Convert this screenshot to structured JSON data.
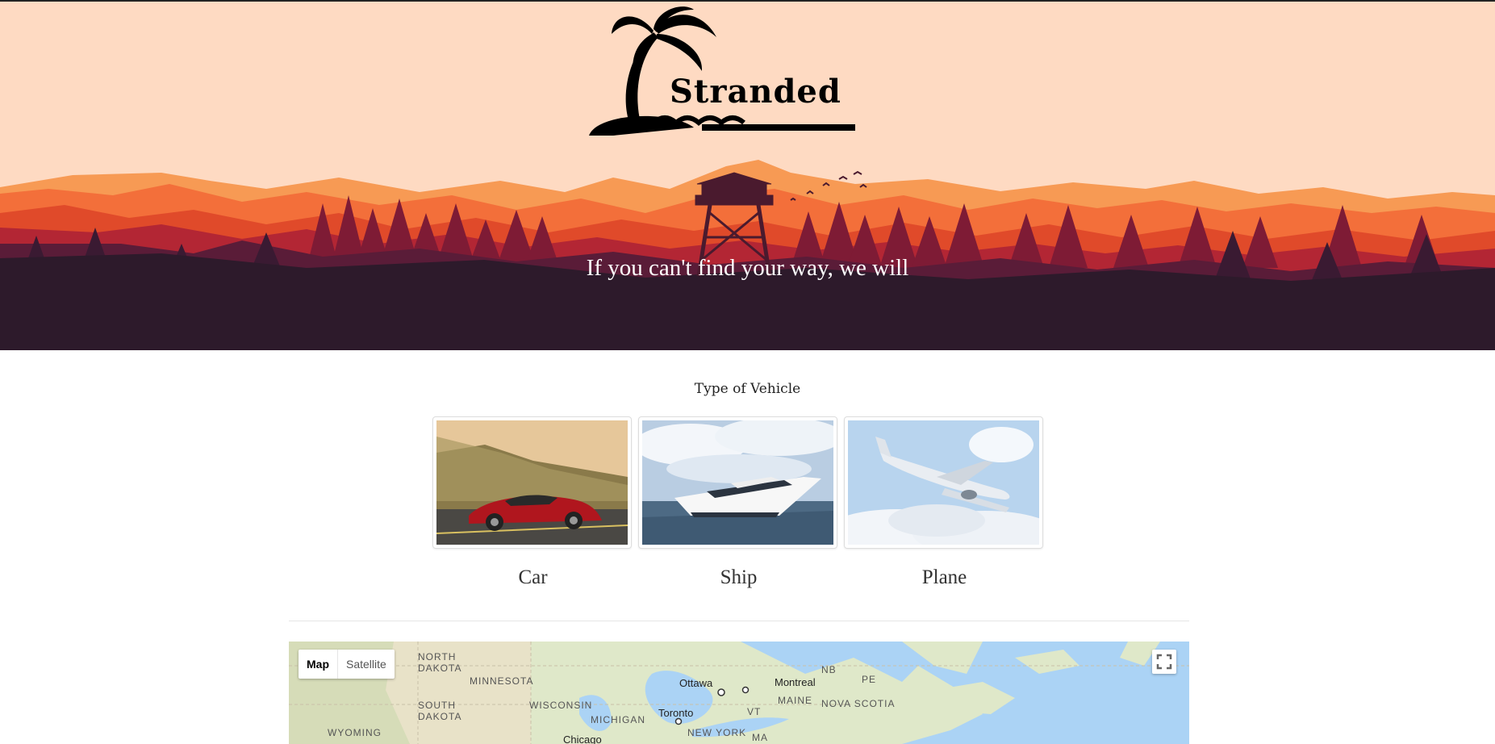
{
  "hero": {
    "logo_text": "Stranded",
    "tagline": "If you can't find your way, we will"
  },
  "vehicles": {
    "title": "Type of Vehicle",
    "items": [
      {
        "label": "Car"
      },
      {
        "label": "Ship"
      },
      {
        "label": "Plane"
      }
    ]
  },
  "map": {
    "type_options": [
      "Map",
      "Satellite"
    ],
    "regions": [
      "NORTH\nDAKOTA",
      "MINNESOTA",
      "SOUTH\nDAKOTA",
      "WYOMING",
      "WISCONSIN",
      "MICHIGAN",
      "NB",
      "PE",
      "MAINE",
      "NOVA SCOTIA",
      "VT",
      "NEW YORK",
      "MA"
    ],
    "cities": [
      "Ottawa",
      "Montreal",
      "Toronto",
      "Chicago"
    ]
  },
  "colors": {
    "hero_sky": "#fedac2",
    "hero_dark": "#2d1a2b",
    "mountain_orange": "#f36f3a",
    "water": "#abd3f5"
  }
}
